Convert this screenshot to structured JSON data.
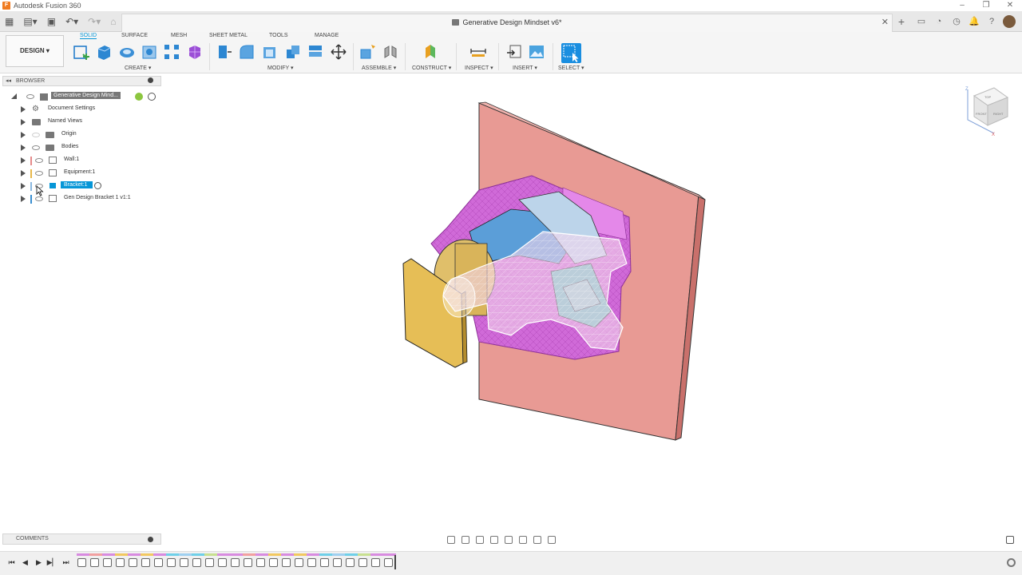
{
  "app": {
    "window_title": "Autodesk Fusion 360",
    "document_tab": "Generative Design Mindset v6*"
  },
  "toolbar": {
    "workspace": "DESIGN",
    "tabs": [
      "SOLID",
      "SURFACE",
      "MESH",
      "SHEET METAL",
      "TOOLS",
      "MANAGE"
    ],
    "active_tab": "SOLID",
    "groups": [
      "CREATE",
      "MODIFY",
      "ASSEMBLE",
      "CONSTRUCT",
      "INSPECT",
      "INSERT",
      "SELECT"
    ]
  },
  "browser": {
    "header": "BROWSER",
    "root": "Generative Design Mind...",
    "items": [
      {
        "label": "Document Settings",
        "icon": "gear-icon"
      },
      {
        "label": "Named Views",
        "icon": "folder-icon"
      },
      {
        "label": "Origin",
        "icon": "folder-icon"
      },
      {
        "label": "Bodies",
        "icon": "folder-icon"
      },
      {
        "label": "Wall:1",
        "icon": "component-icon",
        "color": "#e58a8a"
      },
      {
        "label": "Equipment:1",
        "icon": "component-icon",
        "color": "#e8b84a"
      },
      {
        "label": "Bracket:1",
        "icon": "component-icon",
        "color": "#8ab8e0",
        "selected": true
      },
      {
        "label": "Gen Design Bracket 1 v1:1",
        "icon": "component-icon",
        "color": "#3a8fd0"
      }
    ]
  },
  "comments": {
    "header": "COMMENTS"
  },
  "colors": {
    "accent": "#0696d7",
    "wall": "#e89a94",
    "preserve": "#d06ad8",
    "equipment": "#e6be56",
    "bracket": "#9fb7d6"
  },
  "viewcube": {
    "top": "TOP",
    "front": "FRONT",
    "right": "RIGHT",
    "z": "Z",
    "x": "X"
  }
}
